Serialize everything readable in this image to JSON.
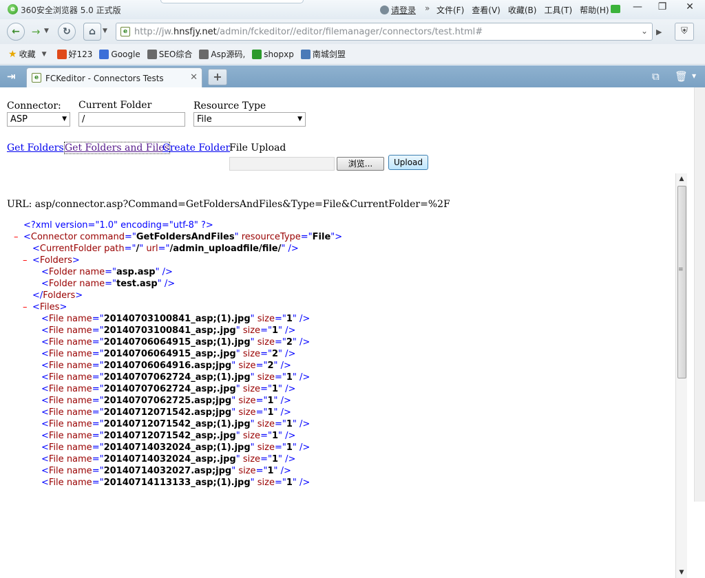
{
  "browser": {
    "title": "360安全浏览器 5.0 正式版",
    "login": "请登录",
    "menu": [
      "文件(F)",
      "查看(V)",
      "收藏(B)",
      "工具(T)",
      "帮助(H)"
    ],
    "address": {
      "prefix": "http://jw.",
      "host": "hnsfjy.net",
      "path": "/admin/fckeditor//editor/filemanager/connectors/test.html#"
    },
    "favorites_label": "收藏",
    "favorites": [
      {
        "label": "好123",
        "icon": "hao123-icon",
        "color": "#e04a1a"
      },
      {
        "label": "Google",
        "icon": "google-icon",
        "color": "#3b6fd8"
      },
      {
        "label": "SEO综合",
        "icon": "seo-icon",
        "color": "#6a6a6a"
      },
      {
        "label": "Asp源码,",
        "icon": "asp-icon",
        "color": "#6a6a6a"
      },
      {
        "label": "shopxp",
        "icon": "shopxp-icon",
        "color": "#2c9a2c"
      },
      {
        "label": "南城剑盟",
        "icon": "page-icon",
        "color": "#4a7ab8"
      }
    ],
    "tab": {
      "title": "FCKeditor - Connectors Tests"
    }
  },
  "form": {
    "connector_label": "Connector:",
    "connector_value": "ASP",
    "folder_label": "Current Folder",
    "folder_value": "/",
    "resource_label": "Resource Type",
    "resource_value": "File",
    "links": [
      "Get Folders",
      "Get Folders and Files",
      "Create Folder"
    ],
    "file_upload_label": "File Upload",
    "browse_label": "浏览...",
    "upload_label": "Upload",
    "url_line": "URL: asp/connector.asp?Command=GetFoldersAndFiles&Type=File&CurrentFolder=%2F"
  },
  "xml": {
    "decl": "<?xml version=\"1.0\" encoding=\"utf-8\" ?>",
    "connector": {
      "command": "GetFoldersAndFiles",
      "resourceType": "File"
    },
    "current_folder": {
      "path": "/",
      "url": "/admin_uploadfile/file/"
    },
    "folders": [
      "asp.asp",
      "test.asp"
    ],
    "files": [
      {
        "name": "20140703100841_asp;(1).jpg",
        "size": "1"
      },
      {
        "name": "20140703100841_asp;.jpg",
        "size": "1"
      },
      {
        "name": "20140706064915_asp;(1).jpg",
        "size": "2"
      },
      {
        "name": "20140706064915_asp;.jpg",
        "size": "2"
      },
      {
        "name": "20140706064916.asp;jpg",
        "size": "2"
      },
      {
        "name": "20140707062724_asp;(1).jpg",
        "size": "1"
      },
      {
        "name": "20140707062724_asp;.jpg",
        "size": "1"
      },
      {
        "name": "20140707062725.asp;jpg",
        "size": "1"
      },
      {
        "name": "20140712071542.asp;jpg",
        "size": "1"
      },
      {
        "name": "20140712071542_asp;(1).jpg",
        "size": "1"
      },
      {
        "name": "20140712071542_asp;.jpg",
        "size": "1"
      },
      {
        "name": "20140714032024_asp;(1).jpg",
        "size": "1"
      },
      {
        "name": "20140714032024_asp;.jpg",
        "size": "1"
      },
      {
        "name": "20140714032027.asp;jpg",
        "size": "1"
      },
      {
        "name": "20140714113133_asp;(1).jpg",
        "size": "1"
      }
    ]
  }
}
